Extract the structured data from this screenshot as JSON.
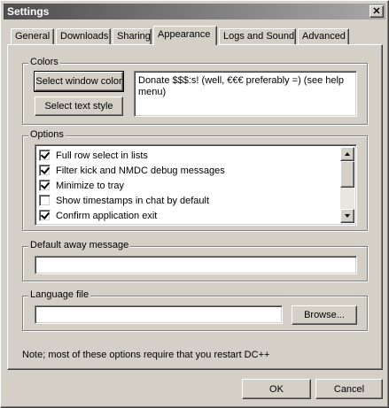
{
  "window": {
    "title": "Settings",
    "close_symbol": "✕"
  },
  "tabs": [
    {
      "label": "General"
    },
    {
      "label": "Downloads"
    },
    {
      "label": "Sharing"
    },
    {
      "label": "Appearance",
      "active": true
    },
    {
      "label": "Logs and Sound"
    },
    {
      "label": "Advanced"
    }
  ],
  "colors": {
    "group_label": "Colors",
    "select_window_color_label": "Select window color",
    "select_text_style_label": "Select text style",
    "preview_text": "Donate $$$:s! (well, €€€ preferably =) (see help menu)"
  },
  "options": {
    "group_label": "Options",
    "items": [
      {
        "label": "Full row select in lists",
        "checked": true
      },
      {
        "label": "Filter kick and NMDC debug messages",
        "checked": true
      },
      {
        "label": "Minimize to tray",
        "checked": true
      },
      {
        "label": "Show timestamps in chat by default",
        "checked": false
      },
      {
        "label": "Confirm application exit",
        "checked": true
      }
    ]
  },
  "away": {
    "group_label": "Default away message",
    "value": ""
  },
  "language": {
    "group_label": "Language file",
    "value": "",
    "browse_label": "Browse..."
  },
  "note": "Note; most of these options require that you restart DC++",
  "footer": {
    "ok_label": "OK",
    "cancel_label": "Cancel"
  }
}
